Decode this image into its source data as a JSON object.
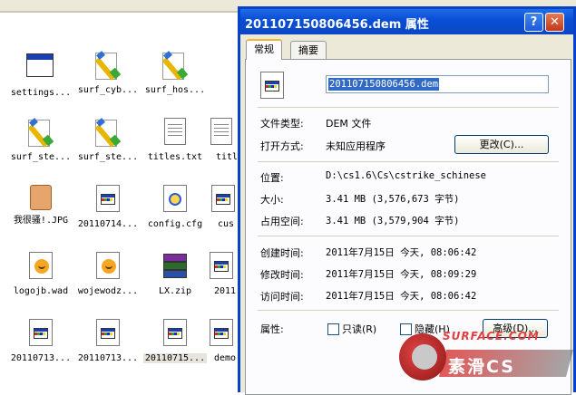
{
  "explorer": {
    "files": [
      {
        "label": "settings...",
        "icon": "window-app-icon"
      },
      {
        "label": "surf_cyb...",
        "icon": "paintbrush-icon"
      },
      {
        "label": "surf_hos...",
        "icon": "paintbrush-icon"
      },
      {
        "label": "surf_ste...",
        "icon": "paintbrush-icon"
      },
      {
        "label": "surf_ste...",
        "icon": "paintbrush-icon"
      },
      {
        "label": "titles.txt",
        "icon": "text-file-icon"
      },
      {
        "label": "titl",
        "icon": "text-file-icon"
      },
      {
        "label": "我很骚!.JPG",
        "icon": "jpg-image-icon"
      },
      {
        "label": "20110714...",
        "icon": "generic-file-icon"
      },
      {
        "label": "config.cfg",
        "icon": "config-file-icon"
      },
      {
        "label": "cus",
        "icon": "generic-file-icon"
      },
      {
        "label": "logojb.wad",
        "icon": "wad-file-icon"
      },
      {
        "label": "wojewodz...",
        "icon": "wad-file-icon"
      },
      {
        "label": "LX.zip",
        "icon": "winrar-archive-icon"
      },
      {
        "label": "2011",
        "icon": "generic-file-icon"
      },
      {
        "label": "20110713...",
        "icon": "generic-file-icon"
      },
      {
        "label": "20110713...",
        "icon": "generic-file-icon"
      },
      {
        "label": "20110715...",
        "icon": "generic-file-icon"
      },
      {
        "label": "demo",
        "icon": "generic-file-icon"
      }
    ]
  },
  "dialog": {
    "title": "201107150806456.dem 属性",
    "help_btn": "?",
    "close_btn": "✕",
    "tabs": [
      {
        "label": "常规",
        "active": true
      },
      {
        "label": "摘要",
        "active": false
      }
    ],
    "filename": "201107150806456.dem",
    "file_type_label": "文件类型:",
    "file_type_value": "DEM 文件",
    "open_with_label": "打开方式:",
    "open_with_value": "未知应用程序",
    "change_btn": "更改(C)...",
    "location_label": "位置:",
    "location_value": "D:\\cs1.6\\Cs\\cstrike_schinese",
    "size_label": "大小:",
    "size_value": "3.41 MB (3,576,673 字节)",
    "disk_size_label": "占用空间:",
    "disk_size_value": "3.41 MB (3,579,904 字节)",
    "created_label": "创建时间:",
    "created_value": "2011年7月15日 今天, 08:06:42",
    "modified_label": "修改时间:",
    "modified_value": "2011年7月15日 今天, 08:09:29",
    "accessed_label": "访问时间:",
    "accessed_value": "2011年7月15日 今天, 08:06:42",
    "attributes_label": "属性:",
    "readonly_label": "只读(R)",
    "hidden_label": "隐藏(H)",
    "advanced_btn": "高级(D)..."
  },
  "watermark": {
    "site": "SURFACE.COM",
    "brand": "素滑CS"
  },
  "colors": {
    "titlebar": "#0a4fd6",
    "dialog_bg": "#ece9d8",
    "selection": "#316ac5"
  }
}
